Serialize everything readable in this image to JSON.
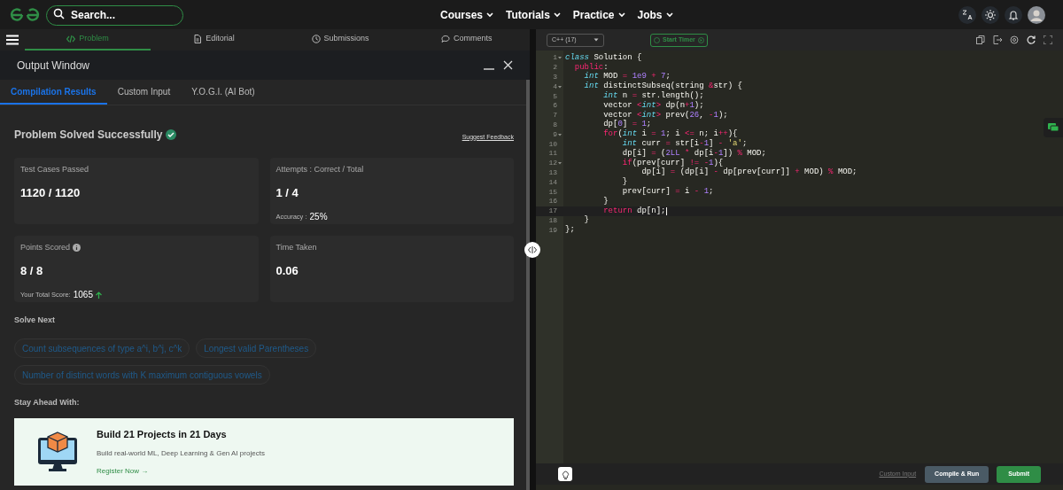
{
  "nav": {
    "search": {
      "placeholder": "Search..."
    },
    "menus": [
      {
        "label": "Courses"
      },
      {
        "label": "Tutorials"
      },
      {
        "label": "Practice"
      },
      {
        "label": "Jobs"
      }
    ]
  },
  "problem_tabs": [
    {
      "label": "Problem",
      "selected": true
    },
    {
      "label": "Editorial",
      "selected": false
    },
    {
      "label": "Submissions",
      "selected": false
    },
    {
      "label": "Comments",
      "selected": false
    }
  ],
  "output_window": {
    "title": "Output Window",
    "tabs": [
      {
        "label": "Compilation Results",
        "selected": true
      },
      {
        "label": "Custom Input",
        "selected": false
      },
      {
        "label": "Y.O.G.I. (AI Bot)",
        "selected": false
      }
    ],
    "status": "Problem Solved Successfully",
    "feedback": "Suggest Feedback",
    "cards": [
      {
        "label": "Test Cases Passed",
        "value": "1120 / 1120"
      },
      {
        "label": "Attempts : Correct / Total",
        "value": "1 / 4",
        "sub_label": "Accuracy :",
        "sub_value": "25%"
      },
      {
        "label": "Points Scored",
        "info": true,
        "value": "8 / 8",
        "sub_label": "Your Total Score:",
        "sub_value": "1065",
        "trend_up": true
      },
      {
        "label": "Time Taken",
        "value": "0.06"
      }
    ],
    "solve_next_heading": "Solve Next",
    "solve_next": [
      "Count subsequences of type a^i, b^j, c^k",
      "Longest valid Parentheses",
      "Number of distinct words with K maximum contiguous vowels"
    ],
    "stay_ahead_heading": "Stay Ahead With:",
    "promo": {
      "title": "Build 21 Projects in 21 Days",
      "text": "Build real-world ML, Deep Learning & Gen AI projects",
      "link": "Register Now",
      "link_arrow": "→"
    }
  },
  "editor": {
    "language": "C++ (17)",
    "timer": "Start Timer",
    "lines": [
      {
        "number": "1",
        "fold": true,
        "active": false,
        "code": "class Solution {"
      },
      {
        "number": "2",
        "fold": false,
        "active": false,
        "code": "  public:"
      },
      {
        "number": "3",
        "fold": false,
        "active": false,
        "code": "    int MOD = 1e9 + 7;"
      },
      {
        "number": "4",
        "fold": true,
        "active": false,
        "code": "    int distinctSubseq(string &str) {"
      },
      {
        "number": "5",
        "fold": false,
        "active": false,
        "code": "        int n = str.length();"
      },
      {
        "number": "6",
        "fold": false,
        "active": false,
        "code": "        vector <int> dp(n+1);"
      },
      {
        "number": "7",
        "fold": false,
        "active": false,
        "code": "        vector <int> prev(26, -1);"
      },
      {
        "number": "8",
        "fold": false,
        "active": false,
        "code": "        dp[0] = 1;"
      },
      {
        "number": "9",
        "fold": true,
        "active": false,
        "code": "        for(int i = 1; i <= n; i++){"
      },
      {
        "number": "10",
        "fold": false,
        "active": false,
        "code": "            int curr = str[i-1] - 'a';"
      },
      {
        "number": "11",
        "fold": false,
        "active": false,
        "code": "            dp[i] = (2LL * dp[i-1]) % MOD;"
      },
      {
        "number": "12",
        "fold": true,
        "active": false,
        "code": "            if(prev[curr] != -1){"
      },
      {
        "number": "13",
        "fold": false,
        "active": false,
        "code": "                dp[i] = (dp[i] - dp[prev[curr]] + MOD) % MOD;"
      },
      {
        "number": "14",
        "fold": false,
        "active": false,
        "code": "            }"
      },
      {
        "number": "15",
        "fold": false,
        "active": false,
        "code": "            prev[curr] = i - 1;"
      },
      {
        "number": "16",
        "fold": false,
        "active": false,
        "code": "        }"
      },
      {
        "number": "17",
        "fold": false,
        "active": true,
        "code": "        return dp[n];"
      },
      {
        "number": "18",
        "fold": false,
        "active": false,
        "code": "    }"
      },
      {
        "number": "19",
        "fold": false,
        "active": false,
        "code": "};"
      }
    ],
    "footer": {
      "custom_input": "Custom Input",
      "compile": "Compile & Run",
      "submit": "Submit"
    }
  }
}
